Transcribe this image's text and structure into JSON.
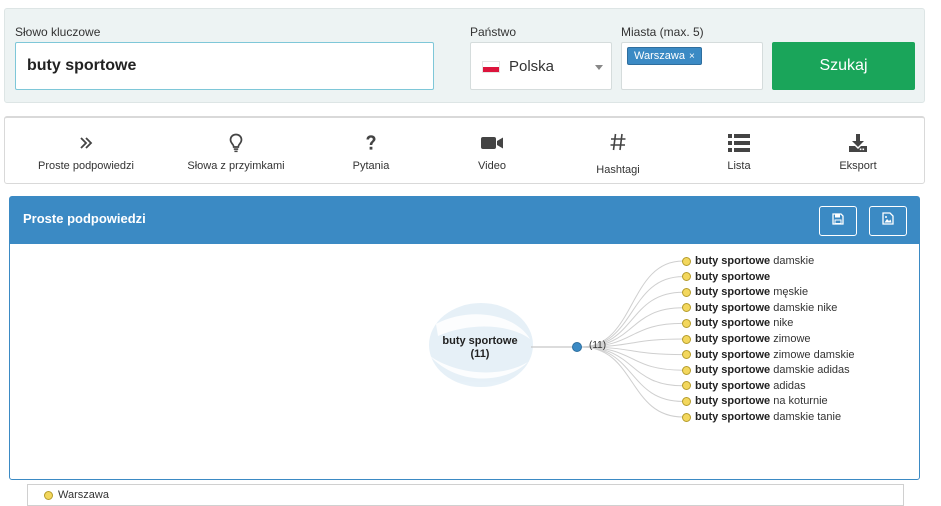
{
  "search": {
    "keyword_label": "Słowo kluczowe",
    "keyword_value": "buty sportowe",
    "country_label": "Państwo",
    "country_value": "Polska",
    "cities_label": "Miasta (max. 5)",
    "city_tag": "Warszawa",
    "city_tag_remove": "×",
    "submit_label": "Szukaj"
  },
  "tabs": [
    {
      "label": "Proste podpowiedzi",
      "icon": "double-chevron-right-icon"
    },
    {
      "label": "Słowa z przyimkami",
      "icon": "lightbulb-icon"
    },
    {
      "label": "Pytania",
      "icon": "question-mark-icon"
    },
    {
      "label": "Video",
      "icon": "video-camera-icon"
    },
    {
      "label": "Hashtagi",
      "icon": "hashtag-icon"
    },
    {
      "label": "Lista",
      "icon": "list-icon"
    },
    {
      "label": "Eksport",
      "icon": "download-icon"
    }
  ],
  "results": {
    "title": "Proste podpowiedzi",
    "save_icon": "save-icon",
    "image_icon": "image-export-icon",
    "root": {
      "line1": "buty sportowe",
      "line2": "(11)"
    },
    "mid_count": "(11)",
    "keyword": "buty sportowe",
    "suggestions": [
      {
        "suffix": " damskie"
      },
      {
        "suffix": ""
      },
      {
        "suffix": " męskie"
      },
      {
        "suffix": " damskie nike"
      },
      {
        "suffix": " nike"
      },
      {
        "suffix": " zimowe"
      },
      {
        "suffix": " zimowe damskie"
      },
      {
        "suffix": " damskie adidas"
      },
      {
        "suffix": " adidas"
      },
      {
        "suffix": " na koturnie"
      },
      {
        "suffix": " damskie tanie"
      }
    ],
    "legend": "Warszawa"
  },
  "colors": {
    "accent": "#3b8ac4",
    "submit": "#1aa55a",
    "leaf_dot": "#f3d75d"
  }
}
